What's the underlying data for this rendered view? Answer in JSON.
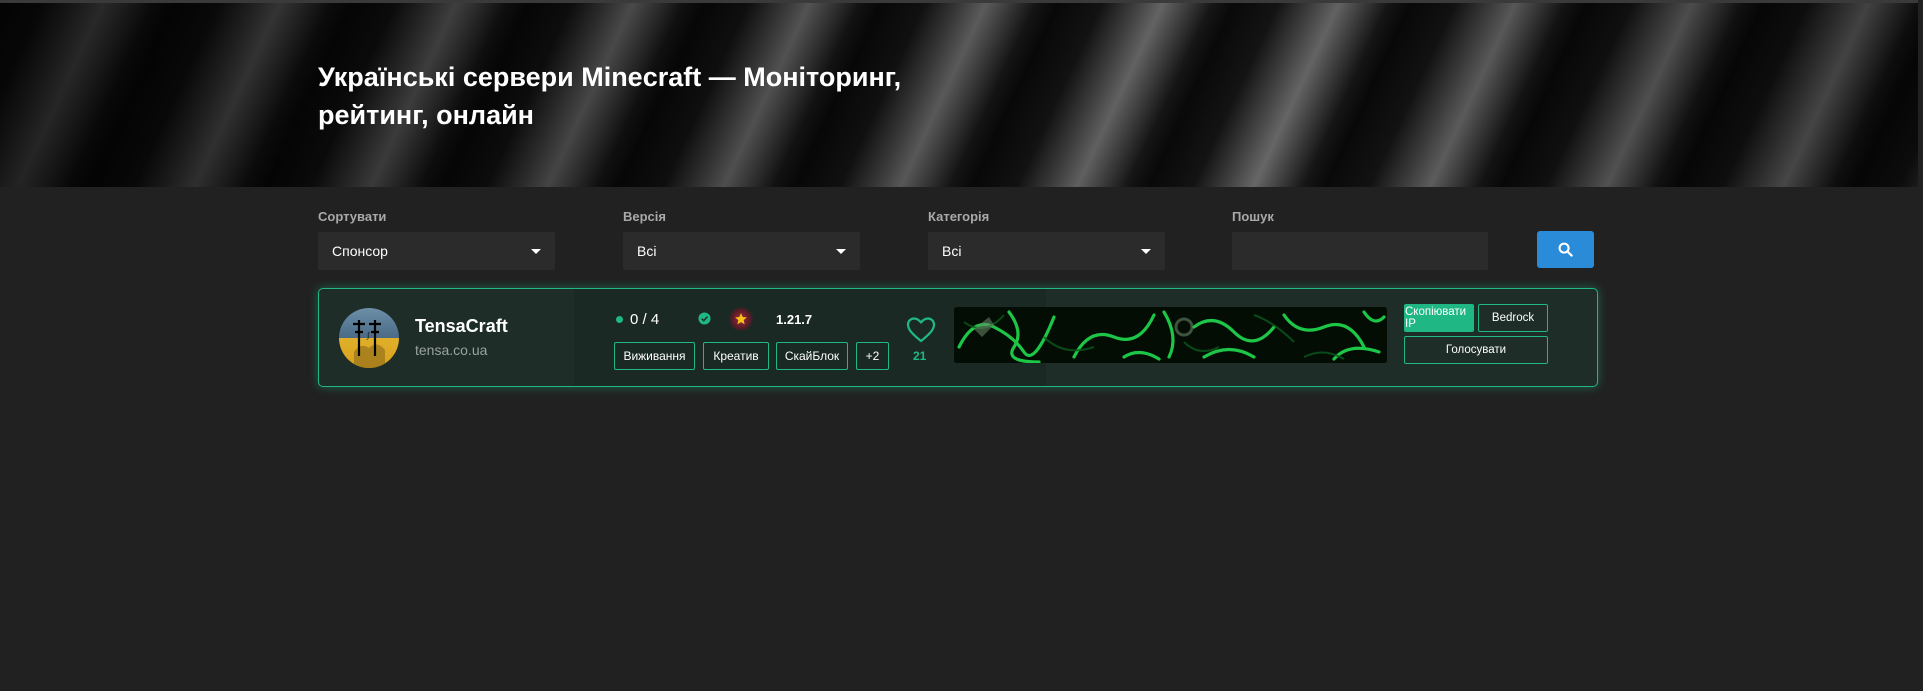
{
  "hero": {
    "title": "Українські сервери Minecraft — Моніторинг, рейтинг, онлайн"
  },
  "filters": {
    "sort": {
      "label": "Сортувати",
      "value": "Спонсор"
    },
    "version": {
      "label": "Версія",
      "value": "Всі"
    },
    "category": {
      "label": "Категорія",
      "value": "Всі"
    },
    "search": {
      "label": "Пошук",
      "placeholder": ""
    }
  },
  "servers": [
    {
      "name": "TensaCraft",
      "host": "tensa.co.ua",
      "online": "0 / 4",
      "version": "1.21.7",
      "tags": [
        "Виживання",
        "Креатив",
        "СкайБлок",
        "+2"
      ],
      "likes": "21",
      "buttons": {
        "copy_ip": "Скопіювати IP",
        "bedrock": "Bedrock",
        "vote": "Голосувати"
      }
    }
  ],
  "colors": {
    "accent": "#1fb884",
    "search_button": "#2a8bd9",
    "background": "#212121",
    "card": "#1e2d27"
  },
  "icons": [
    "search-icon",
    "caret-down-icon",
    "status-dot-icon",
    "verified-icon",
    "star-icon",
    "heart-icon"
  ]
}
